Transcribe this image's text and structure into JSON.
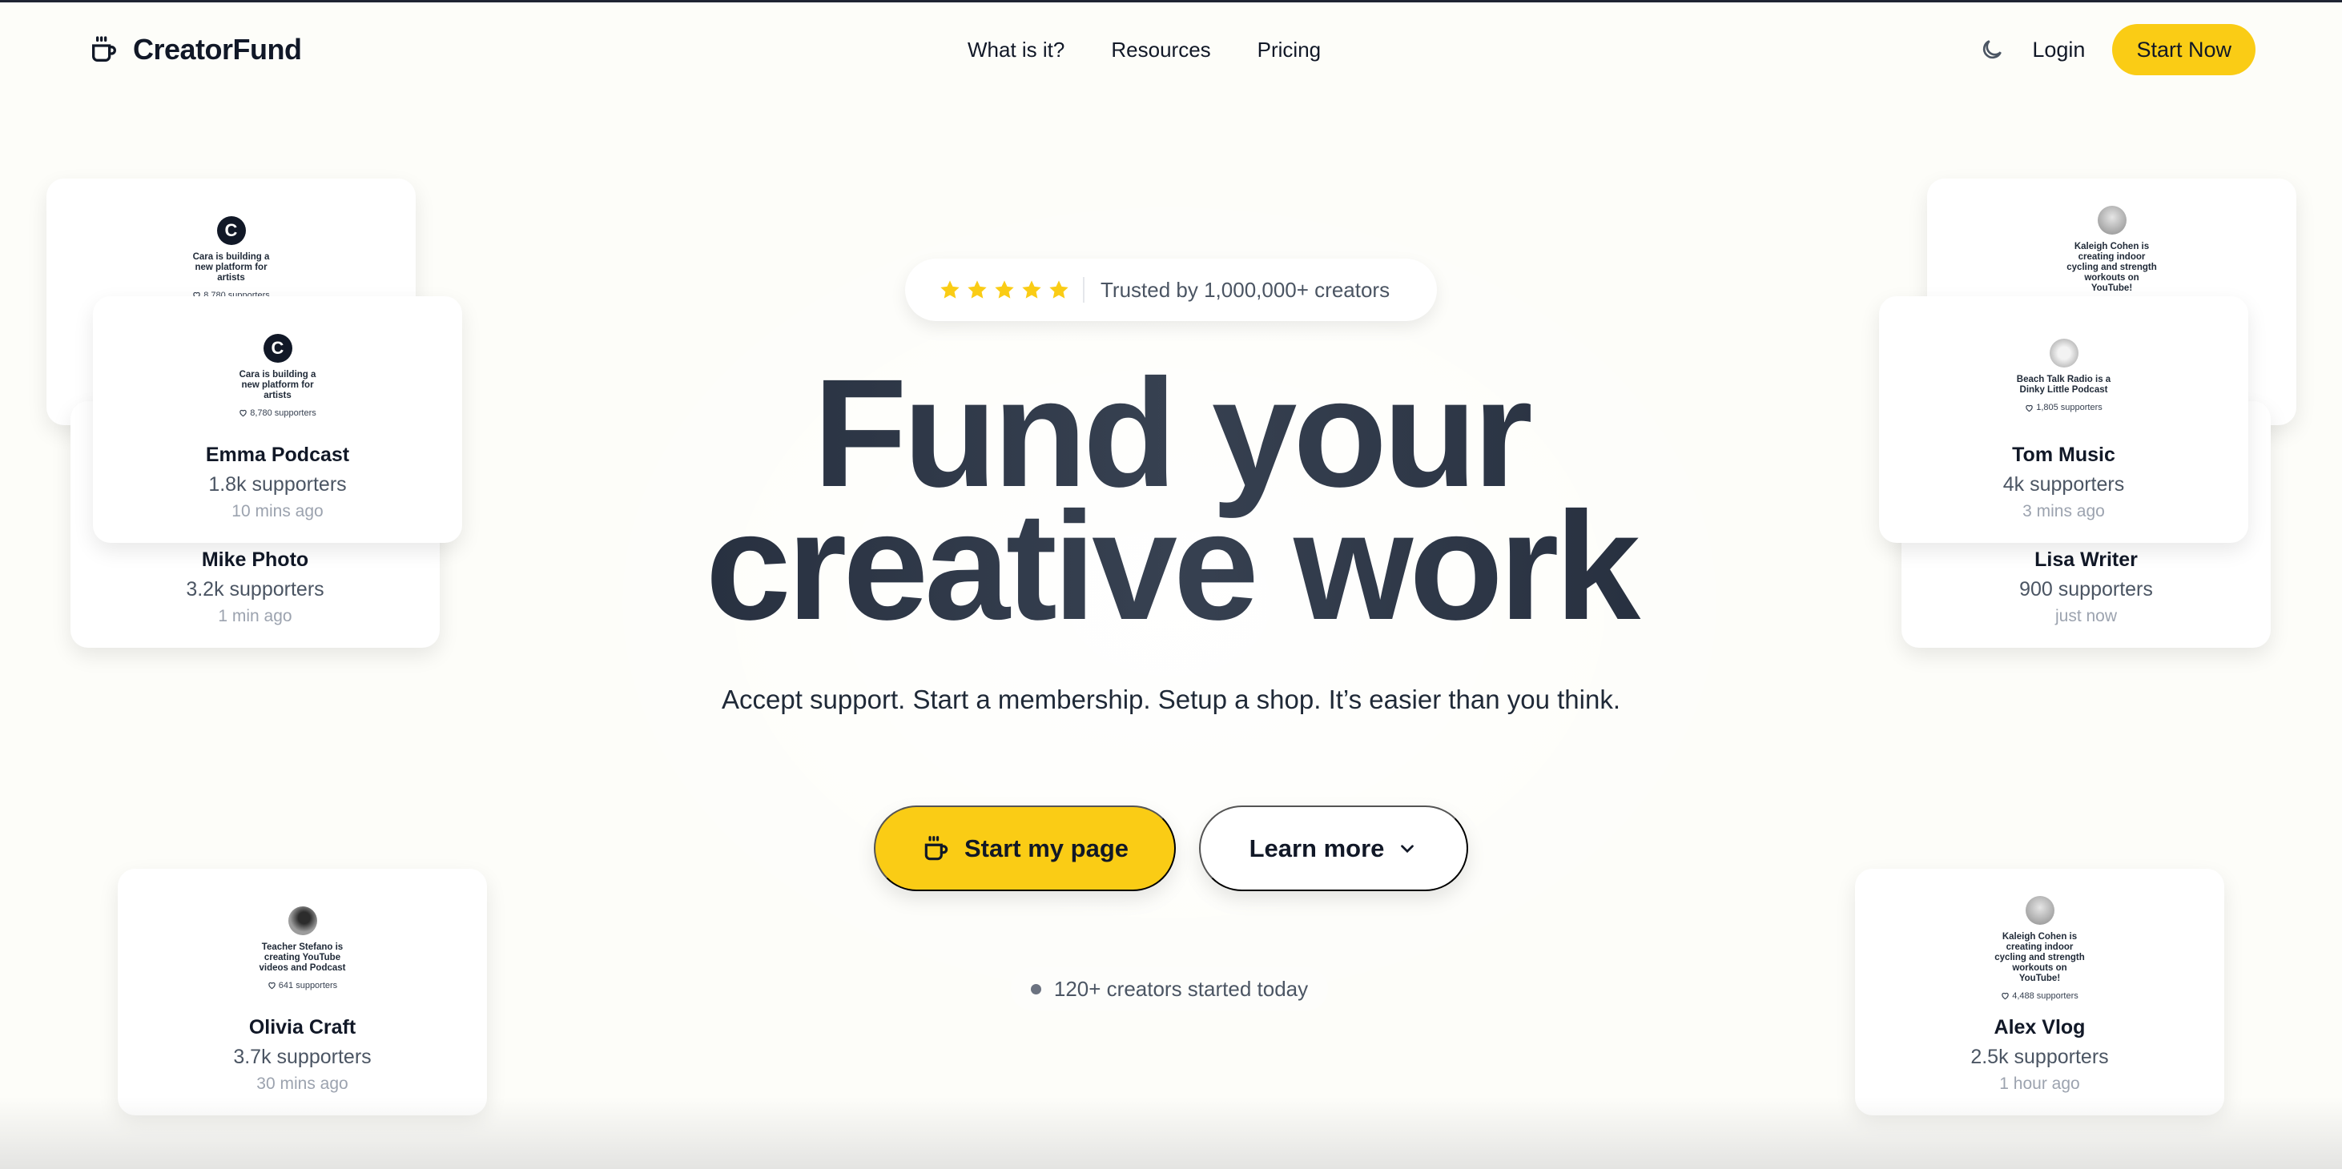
{
  "header": {
    "brand": "CreatorFund",
    "nav": [
      "What is it?",
      "Resources",
      "Pricing"
    ],
    "login": "Login",
    "start_now": "Start Now",
    "theme_icon": "moon-icon"
  },
  "hero": {
    "rating_stars": 5,
    "trusted_text": "Trusted by 1,000,000+ creators",
    "title_line1": "Fund your",
    "title_line2": "creative work",
    "subtitle": "Accept support. Start a membership. Setup a shop. It’s easier than you think.",
    "primary_cta": "Start my page",
    "secondary_cta": "Learn more",
    "live_text": "120+ creators started today"
  },
  "colors": {
    "accent": "#facc15",
    "text": "#111827",
    "background": "#fdfdf9"
  },
  "cards": [
    {
      "id": "cara-back",
      "preview": {
        "avatar": "cara",
        "description": "Cara is building a new platform for artists",
        "supporters": "8,780 supporters"
      }
    },
    {
      "id": "mike",
      "name": "Mike Photo",
      "supporters": "3.2k supporters",
      "time": "1 min ago"
    },
    {
      "id": "emma",
      "preview": {
        "avatar": "cara",
        "description": "Cara is building a new platform for artists",
        "supporters": "8,780 supporters"
      },
      "name": "Emma Podcast",
      "supporters": "1.8k supporters",
      "time": "10 mins ago"
    },
    {
      "id": "kaleigh-back",
      "preview": {
        "avatar": "photo",
        "description": "Kaleigh Cohen is creating indoor cycling and strength workouts on YouTube!",
        "supporters": "4,488 supporters"
      }
    },
    {
      "id": "lisa",
      "name": "Lisa Writer",
      "supporters": "900 supporters",
      "time": "just now"
    },
    {
      "id": "tom",
      "preview": {
        "avatar": "radio",
        "description": "Beach Talk Radio is a Dinky Little Podcast",
        "supporters": "1,805 supporters"
      },
      "name": "Tom Music",
      "supporters": "4k supporters",
      "time": "3 mins ago"
    },
    {
      "id": "olivia",
      "preview": {
        "avatar": "man",
        "description": "Teacher Stefano is creating YouTube videos and Podcast",
        "supporters": "641 supporters"
      },
      "name": "Olivia Craft",
      "supporters": "3.7k supporters",
      "time": "30 mins ago"
    },
    {
      "id": "alex",
      "preview": {
        "avatar": "photo",
        "description": "Kaleigh Cohen is creating indoor cycling and strength workouts on YouTube!",
        "supporters": "4,488 supporters"
      },
      "name": "Alex Vlog",
      "supporters": "2.5k supporters",
      "time": "1 hour ago"
    }
  ]
}
